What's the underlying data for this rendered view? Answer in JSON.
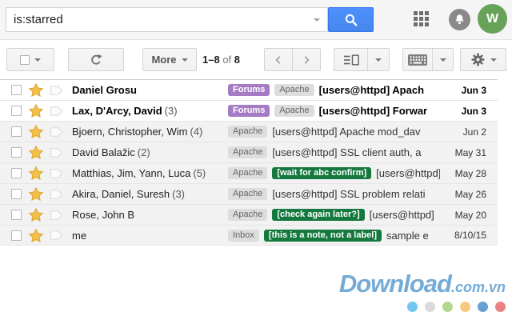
{
  "topbar": {
    "search_value": "is:starred",
    "avatar_letter": "W"
  },
  "toolbar": {
    "more_label": "More",
    "pagination": {
      "range": "1–8",
      "of_word": "of",
      "total": "8"
    }
  },
  "icons": {
    "search": "magnifier-icon",
    "apps": "grid-3x3-icon",
    "notifications": "bell-icon",
    "refresh": "circular-arrow-icon",
    "prev": "chevron-left-icon",
    "next": "chevron-right-icon",
    "view_toggle": "split-pane-icon",
    "input_tools": "keyboard-icon",
    "settings": "gear-icon",
    "star": "star-icon",
    "importance": "importance-marker-icon"
  },
  "list": {
    "rows": [
      {
        "unread": true,
        "sender": "Daniel Grosu",
        "count": "",
        "chips": [
          {
            "text": "Forums",
            "type": "purple"
          },
          {
            "text": "Apache",
            "type": "gray"
          }
        ],
        "subject": "[users@httpd] Apach",
        "date": "Jun 3"
      },
      {
        "unread": true,
        "sender": "Lax, D'Arcy, David",
        "count": "(3)",
        "chips": [
          {
            "text": "Forums",
            "type": "purple"
          },
          {
            "text": "Apache",
            "type": "gray"
          }
        ],
        "subject": "[users@httpd] Forwar",
        "date": "Jun 3"
      },
      {
        "unread": false,
        "sender": "Bjoern, Christopher, Wim",
        "count": "(4)",
        "chips": [
          {
            "text": "Apache",
            "type": "gray"
          }
        ],
        "subject": "[users@httpd] Apache mod_dav",
        "date": "Jun 2"
      },
      {
        "unread": false,
        "sender": "David Balažic",
        "count": "(2)",
        "chips": [
          {
            "text": "Apache",
            "type": "gray"
          }
        ],
        "subject": "[users@httpd] SSL client auth, a",
        "date": "May 31"
      },
      {
        "unread": false,
        "sender": "Matthias, Jim, Yann, Luca",
        "count": "(5)",
        "chips": [
          {
            "text": "Apache",
            "type": "gray"
          },
          {
            "text": "[wait for abc confirm]",
            "type": "green"
          }
        ],
        "subject": "[users@httpd]",
        "date": "May 28"
      },
      {
        "unread": false,
        "sender": "Akira, Daniel, Suresh",
        "count": "(3)",
        "chips": [
          {
            "text": "Apache",
            "type": "gray"
          }
        ],
        "subject": "[users@httpd] SSL problem relati",
        "date": "May 26"
      },
      {
        "unread": false,
        "sender": "Rose, John B",
        "count": "",
        "chips": [
          {
            "text": "Apache",
            "type": "gray"
          },
          {
            "text": "[check again later?]",
            "type": "green"
          }
        ],
        "subject": "[users@httpd]",
        "date": "May 20"
      },
      {
        "unread": false,
        "sender": "me",
        "count": "",
        "chips": [
          {
            "text": "Inbox",
            "type": "gray"
          },
          {
            "text": "[this is a note, not a label]",
            "type": "green"
          }
        ],
        "subject": "sample e",
        "date": "8/10/15"
      }
    ]
  },
  "watermark": {
    "brand": "Download",
    "suffix": ".com.vn",
    "dot_colors": [
      "#72c7f0",
      "#d9d9d9",
      "#b2d88c",
      "#f6c980",
      "#67a0d2",
      "#ec8183"
    ]
  },
  "colors": {
    "accent_blue": "#4787ed",
    "star_gold": "#f0c04b",
    "label_purple": "#a67bc5",
    "label_gray": "#dddddd",
    "note_green": "#15793f",
    "avatar_green": "#66a257",
    "watermark_blue": "#74abd6",
    "read_row_bg": "#f2f2f2"
  }
}
